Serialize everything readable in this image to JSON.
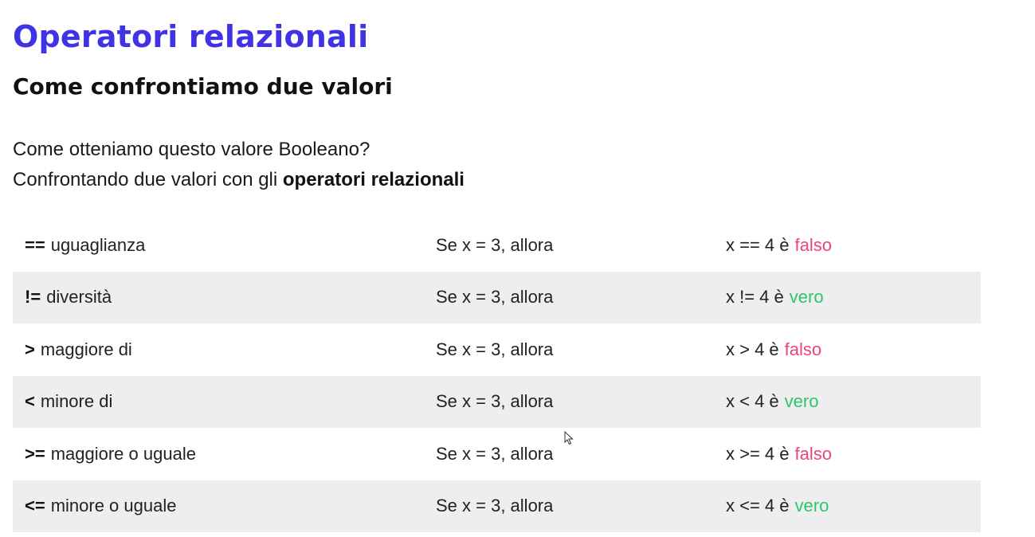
{
  "title": "Operatori relazionali",
  "subtitle": "Come confrontiamo due valori",
  "intro": {
    "line1": "Come otteniamo questo valore Booleano?",
    "line2_prefix": "Confrontando due valori con gli",
    "line2_bold": "operatori relazionali"
  },
  "colors": {
    "title": "#3f33e3",
    "false": "#e8457c",
    "true": "#2fc56a",
    "row_alt_bg": "#eeeef0"
  },
  "rows": [
    {
      "op": "==",
      "desc": "uguaglianza",
      "condition": "Se x = 3, allora",
      "expr": "x == 4 è",
      "result": "falso",
      "result_type": "false"
    },
    {
      "op": "!=",
      "desc": "diversità",
      "condition": "Se x = 3, allora",
      "expr": "x != 4 è",
      "result": "vero",
      "result_type": "true"
    },
    {
      "op": ">",
      "desc": "maggiore di",
      "condition": "Se x = 3, allora",
      "expr": "x > 4 è",
      "result": "falso",
      "result_type": "false"
    },
    {
      "op": "<",
      "desc": "minore di",
      "condition": "Se x = 3, allora",
      "expr": "x < 4 è",
      "result": "vero",
      "result_type": "true"
    },
    {
      "op": ">=",
      "desc": "maggiore o uguale",
      "condition": "Se x = 3, allora",
      "expr": "x >= 4 è",
      "result": "falso",
      "result_type": "false"
    },
    {
      "op": "<=",
      "desc": "minore o uguale",
      "condition": "Se x = 3, allora",
      "expr": "x <= 4 è",
      "result": "vero",
      "result_type": "true"
    }
  ],
  "cursor": {
    "icon": "mouse-pointer-icon"
  }
}
